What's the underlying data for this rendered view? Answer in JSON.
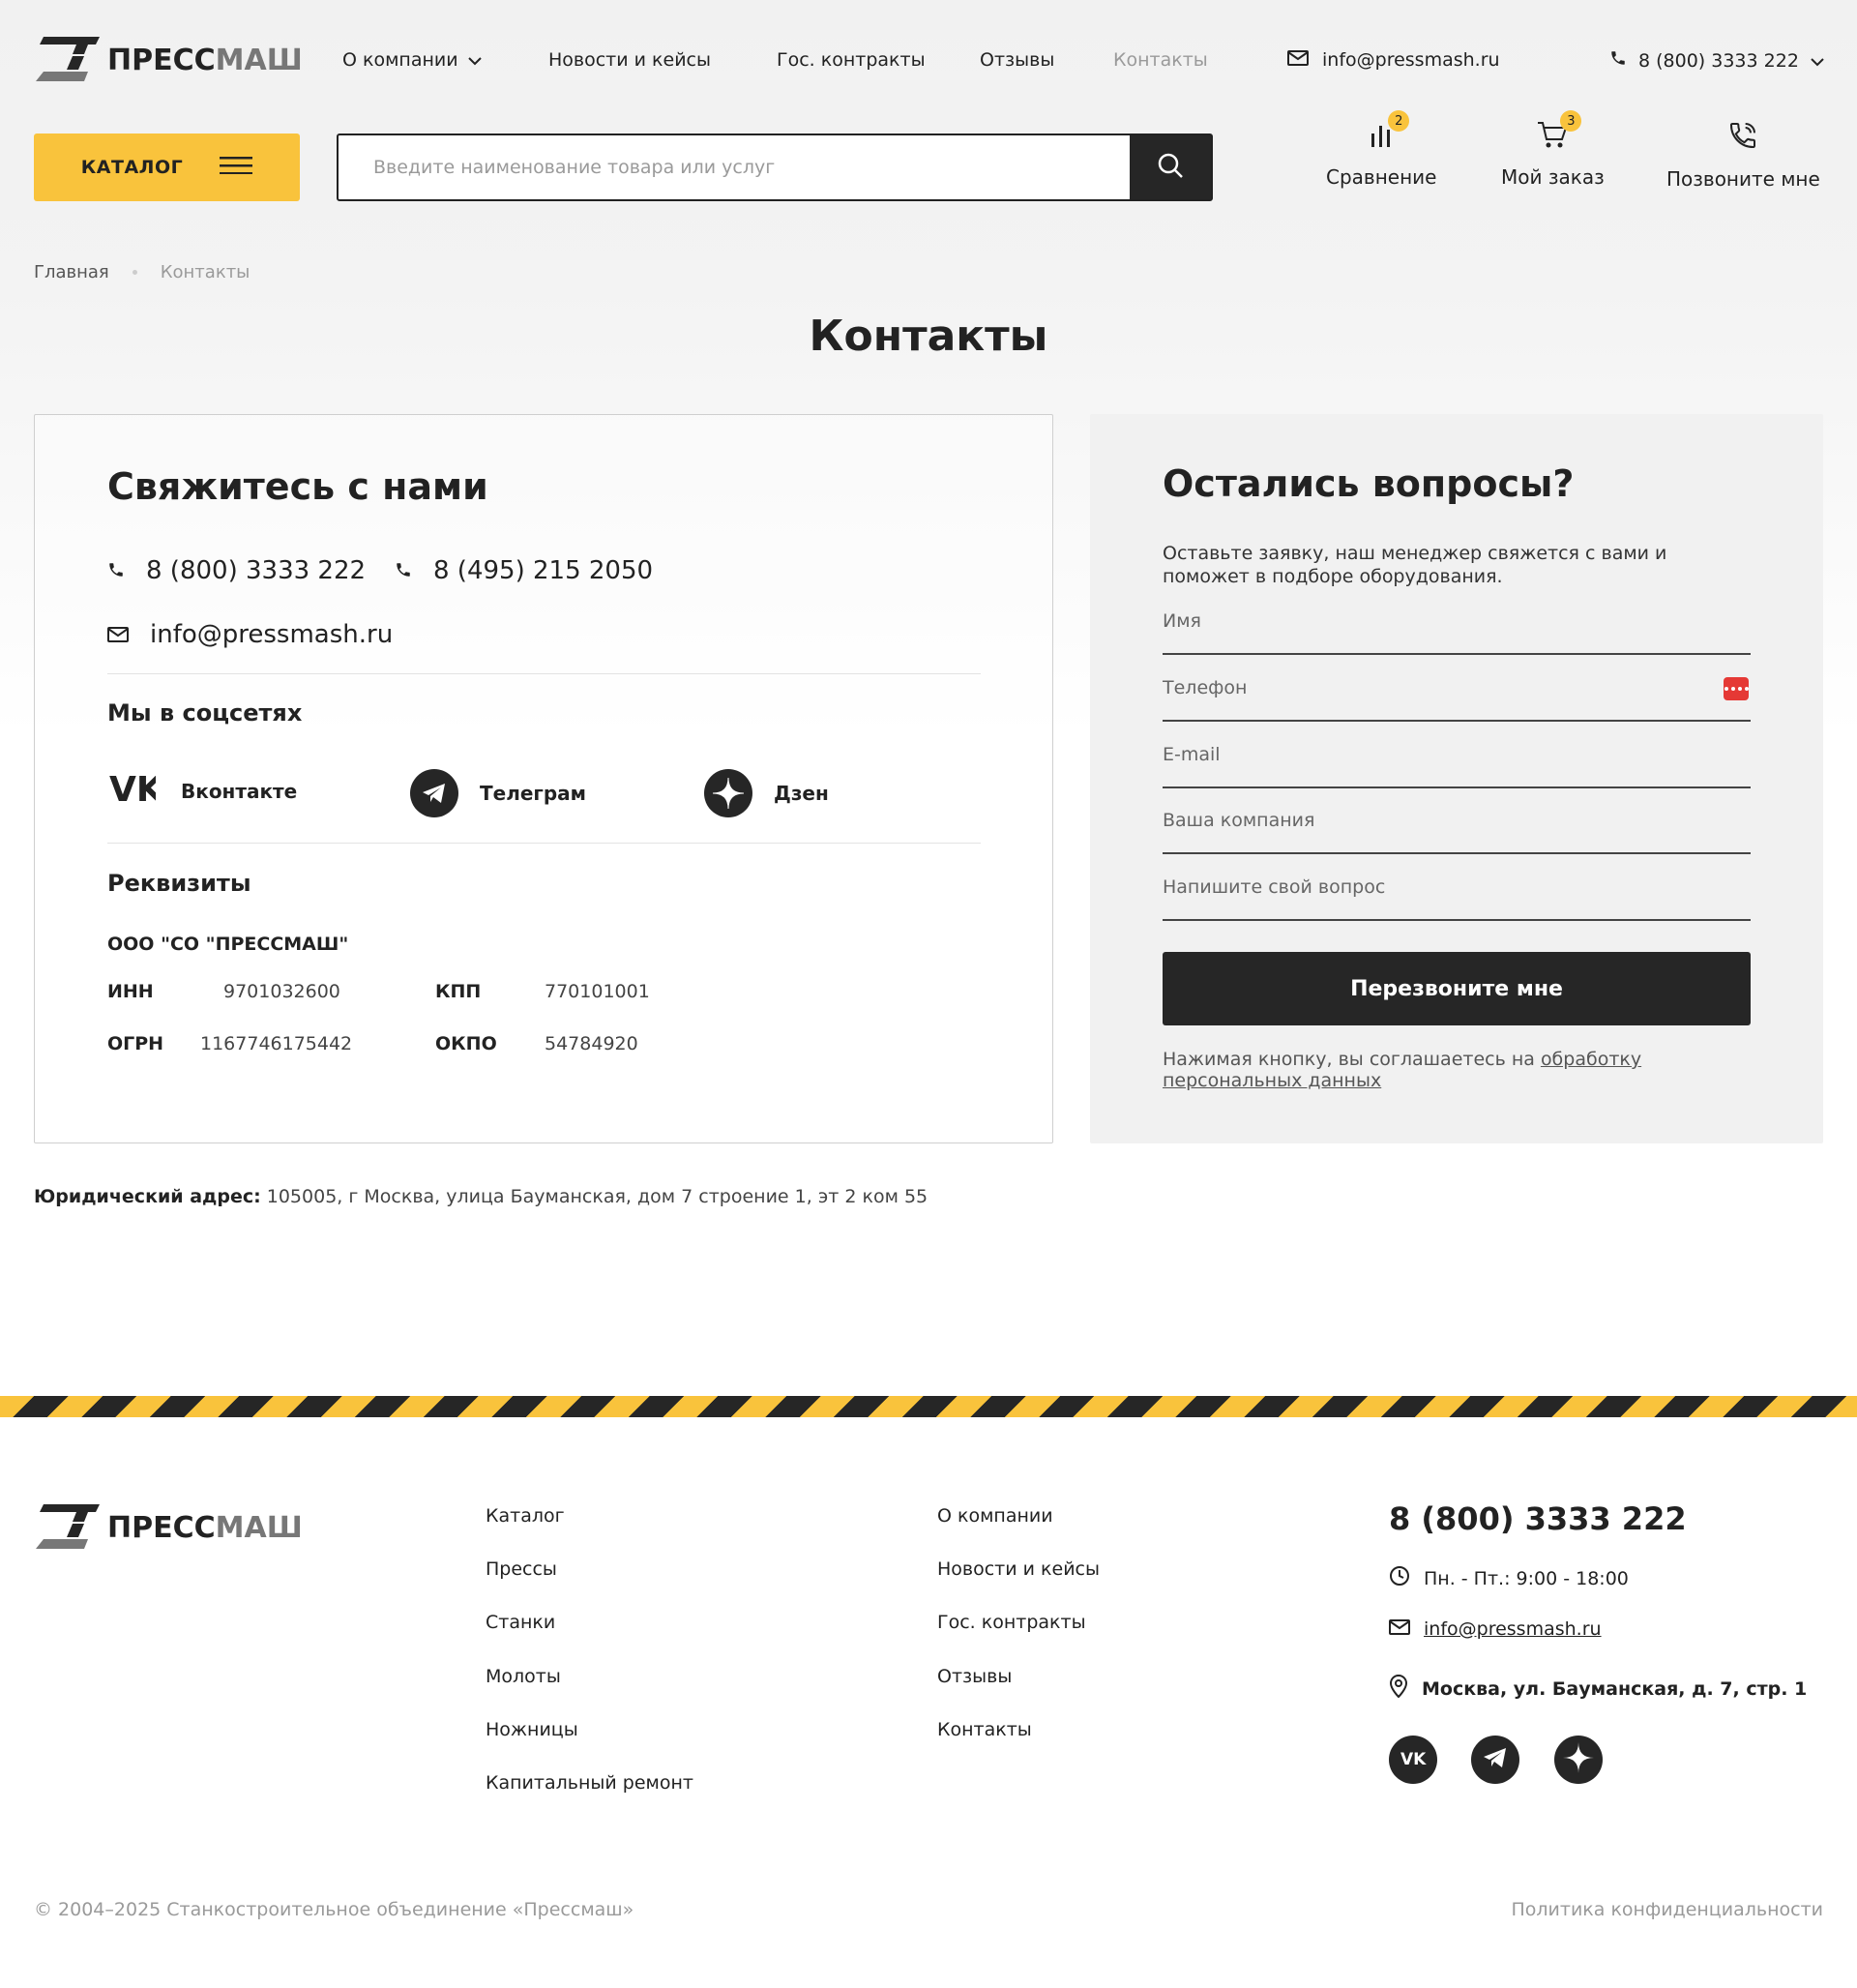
{
  "header": {
    "logo_text_a": "ПРЕСС",
    "logo_text_b": "МАШ",
    "nav": [
      {
        "label": "О компании"
      },
      {
        "label": "Новости и кейсы"
      },
      {
        "label": "Гос. контракты"
      },
      {
        "label": "Отзывы"
      },
      {
        "label": "Контакты"
      }
    ],
    "email": "info@pressmash.ru",
    "phone": "8 (800) 3333 222",
    "catalog_label": "КАТАЛОГ",
    "search_placeholder": "Введите наименование товара или услуг",
    "actions": [
      {
        "label": "Сравнение",
        "badge": "2"
      },
      {
        "label": "Мой заказ",
        "badge": "3"
      },
      {
        "label": "Позвоните мне"
      }
    ]
  },
  "breadcrumb": {
    "home": "Главная",
    "current": "Контакты"
  },
  "page_title": "Контакты",
  "contact": {
    "title": "Свяжитесь с нами",
    "phone1": "8 (800) 3333 222",
    "phone2": "8 (495) 215 2050",
    "email": "info@pressmash.ru",
    "social_title": "Мы в соцсетях",
    "socials": [
      {
        "label": "Вконтакте"
      },
      {
        "label": "Телеграм"
      },
      {
        "label": "Дзен"
      }
    ],
    "requisites_title": "Реквизиты",
    "company": "ООО \"СО \"ПРЕССМАШ\"",
    "inn_label": "ИНН",
    "inn": "9701032600",
    "kpp_label": "КПП",
    "kpp": "770101001",
    "ogrn_label": "ОГРН",
    "ogrn": "1167746175442",
    "okpo_label": "ОКПО",
    "okpo": "54784920"
  },
  "form": {
    "title": "Остались вопросы?",
    "text": "Оставьте заявку, наш менеджер свяжется с вами и поможет в подборе оборудования.",
    "name_placeholder": "Имя",
    "phone_placeholder": "Телефон",
    "email_placeholder": "E-mail",
    "company_placeholder": "Ваша компания",
    "question_placeholder": "Напишите свой вопрос",
    "submit_label": "Перезвоните мне",
    "consent_text": "Нажимая кнопку, вы соглашаетесь на ",
    "consent_link": "обработку персональных данных"
  },
  "legal": {
    "label": "Юридический адрес:",
    "address": " 105005, г Москва, улица Бауманская, дом 7 строение 1, эт 2 ком 55"
  },
  "footer": {
    "col1": [
      "Каталог",
      "Прессы",
      "Станки",
      "Молоты",
      "Ножницы",
      "Капитальный ремонт"
    ],
    "col2": [
      "О компании",
      "Новости и кейсы",
      "Гос. контракты",
      "Отзывы",
      "Контакты"
    ],
    "phone": "8 (800) 3333 222",
    "hours": "Пн. - Пт.: 9:00 - 18:00",
    "email": "info@pressmash.ru",
    "address": "Москва, ул. Бауманская, д. 7, стр. 1",
    "copyright": "© 2004–2025 Станкостроительное объединение «Прессмаш»",
    "privacy": "Политика конфиденциальности"
  },
  "colors": {
    "accent": "#f9c33c",
    "dark": "#262626",
    "error": "#e53935"
  }
}
